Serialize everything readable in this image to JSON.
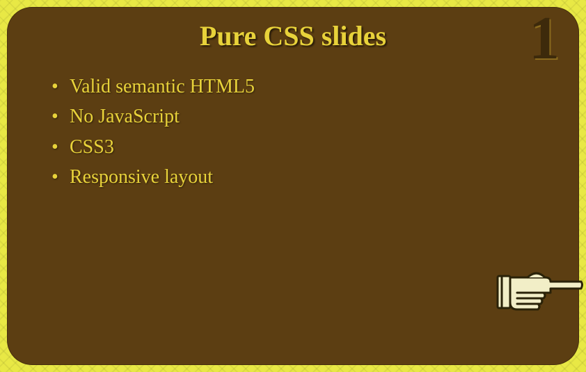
{
  "slide": {
    "title": "Pure CSS slides",
    "page_number": "1",
    "bullets": [
      "Valid semantic HTML5",
      "No JavaScript",
      "CSS3",
      "Responsive layout"
    ]
  }
}
